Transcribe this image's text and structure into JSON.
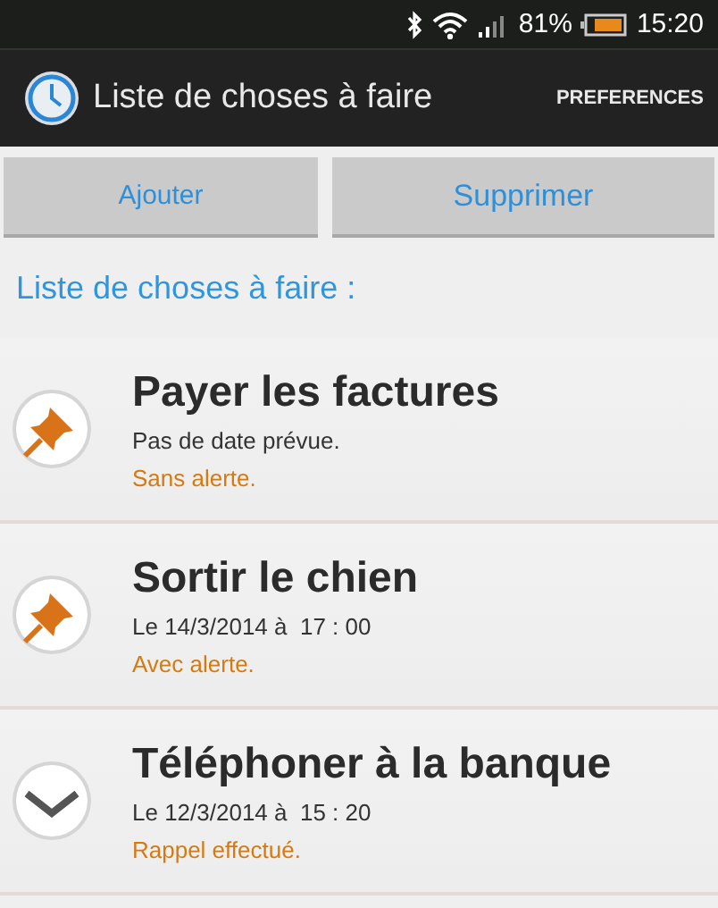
{
  "status_bar": {
    "battery_percent": "81%",
    "time": "15:20"
  },
  "action_bar": {
    "title": "Liste de choses à faire",
    "menu": "PREFERENCES"
  },
  "buttons": [
    "Ajouter",
    "Supprimer"
  ],
  "list_heading": "Liste de choses à faire :",
  "tasks": [
    {
      "kind": "pin",
      "title": "Payer les factures",
      "date": "Pas de date prévue.",
      "alert": "Sans alerte."
    },
    {
      "kind": "pin",
      "title": "Sortir le chien",
      "date": "Le 14/3/2014 à  17 : 00",
      "alert": "Avec alerte."
    },
    {
      "kind": "done",
      "title": "Téléphoner à la banque",
      "date": "Le 12/3/2014 à  15 : 20",
      "alert": "Rappel effectué."
    }
  ]
}
